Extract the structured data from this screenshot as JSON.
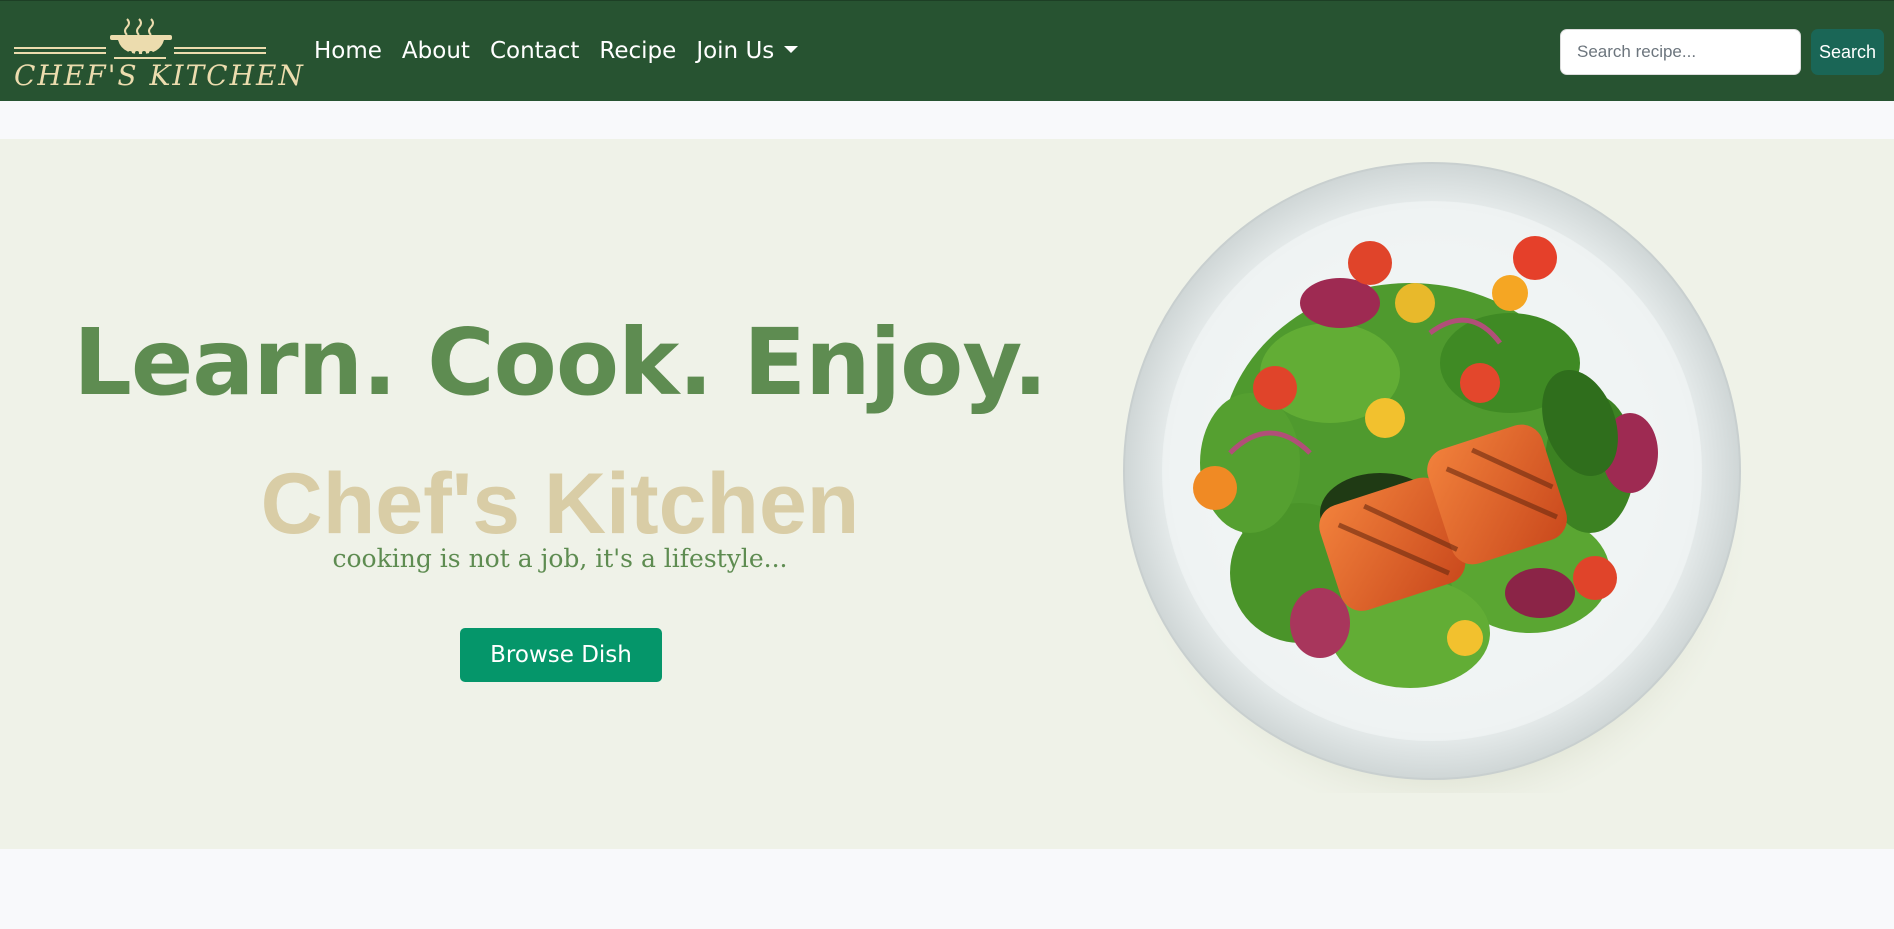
{
  "navbar": {
    "brand": "CHEF'S KITCHEN",
    "links": [
      {
        "label": "Home"
      },
      {
        "label": "About"
      },
      {
        "label": "Contact"
      },
      {
        "label": "Recipe"
      },
      {
        "label": "Join Us"
      }
    ],
    "search": {
      "placeholder": "Search recipe...",
      "value": "",
      "button_label": "Search"
    }
  },
  "hero": {
    "heading": "Learn. Cook. Enjoy.",
    "brand": "Chef's Kitchen",
    "tagline": "cooking is not a job, it's a lifestyle...",
    "cta_label": "Browse Dish"
  },
  "colors": {
    "navbar_bg": "#275331",
    "hero_bg": "#eff2e8",
    "heading_green": "#5e8c51",
    "brand_tan": "#d9cda6",
    "cta_green": "#05966a",
    "search_button": "#1a6656"
  },
  "icons": {
    "logo": "steaming-pot-icon",
    "dropdown": "caret-down-icon",
    "hero_image": "salmon-salad-plate"
  }
}
